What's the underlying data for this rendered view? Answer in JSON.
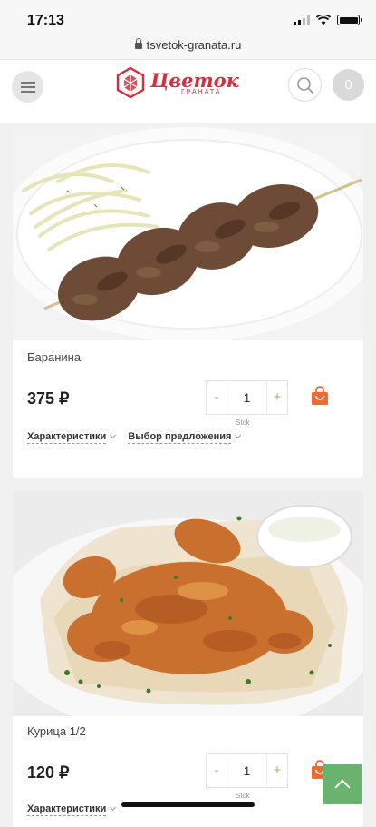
{
  "status": {
    "time": "17:13"
  },
  "browser": {
    "url": "tsvetok-granata.ru"
  },
  "header": {
    "logo_text": "Цветок",
    "logo_subtext": "ГРАНАТА",
    "cart_count": "0"
  },
  "products": [
    {
      "name": "Баранина",
      "price": "375 ₽",
      "quantity": "1",
      "unit": "Stck",
      "minus": "-",
      "plus": "+",
      "characteristics_label": "Характеристики",
      "offer_label": "Выбор предложения"
    },
    {
      "name": "Курица 1/2",
      "price": "120 ₽",
      "quantity": "1",
      "unit": "Stck",
      "minus": "-",
      "plus": "+",
      "characteristics_label": "Характеристики"
    }
  ],
  "colors": {
    "brand": "#d6303e",
    "accent_cart": "#f06a35",
    "scroll_top": "#6ab36f"
  }
}
